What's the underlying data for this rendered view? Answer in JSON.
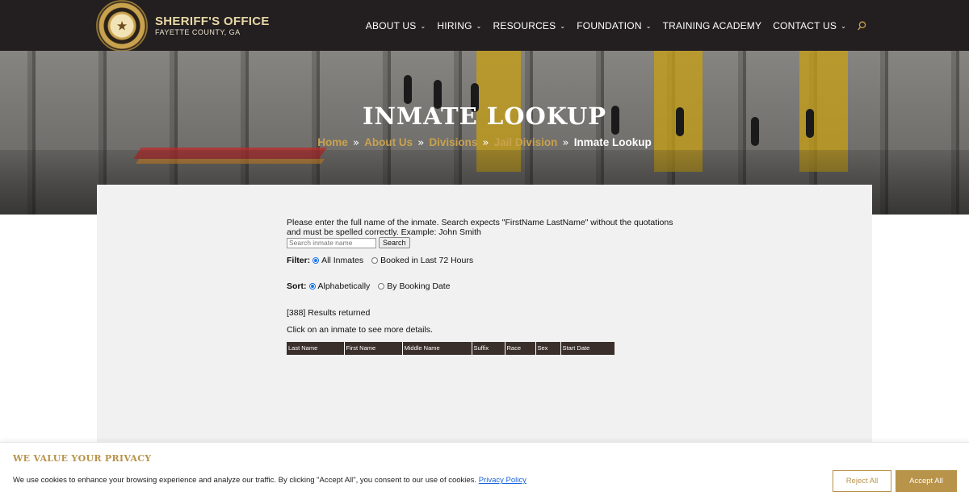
{
  "header": {
    "brand_title": "SHERIFF'S OFFICE",
    "brand_subtitle": "FAYETTE COUNTY, GA",
    "nav": [
      {
        "label": "ABOUT US",
        "icon": "chevron-down-icon"
      },
      {
        "label": "HIRING",
        "icon": "chevron-down-icon"
      },
      {
        "label": "RESOURCES",
        "icon": "chevron-down-icon"
      },
      {
        "label": "FOUNDATION",
        "icon": "chevron-down-icon"
      },
      {
        "label": "TRAINING ACADEMY"
      },
      {
        "label": "CONTACT US",
        "icon": "chevron-down-icon"
      }
    ],
    "search_icon": "search-icon"
  },
  "hero": {
    "title": "INMATE LOOKUP",
    "breadcrumbs": [
      "Home",
      "About Us",
      "Divisions",
      "Jail Division",
      "Inmate Lookup"
    ],
    "separator": "»"
  },
  "lookup": {
    "instructions": "Please enter the full name of the inmate. Search expects \"FirstName LastName\" without the quotations and must be spelled correctly. Example: John Smith",
    "search_placeholder": "Search inmate name",
    "search_button": "Search",
    "filter_label": "Filter:",
    "filter_options": [
      {
        "label": "All Inmates",
        "selected": true
      },
      {
        "label": "Booked in Last 72 Hours",
        "selected": false
      }
    ],
    "sort_label": "Sort:",
    "sort_options": [
      {
        "label": "Alphabetically",
        "selected": true
      },
      {
        "label": "By Booking Date",
        "selected": false
      }
    ],
    "results_text": "[388] Results returned",
    "details_hint": "Click on an inmate to see more details.",
    "table_columns": [
      "Last Name",
      "First Name",
      "Middle Name",
      "Suffix",
      "Race",
      "Sex",
      "Start Date"
    ]
  },
  "cookie_banner": {
    "title": "WE VALUE YOUR PRIVACY",
    "text": "We use cookies to enhance your browsing experience and analyze our traffic. By clicking \"Accept All\", you consent to our use of cookies.",
    "link": "Privacy Policy",
    "reject_button": "Reject All",
    "accept_button": "Accept All"
  },
  "colors": {
    "header_bg": "#231f20",
    "gold_accent": "#c9a24e",
    "cookie_gold": "#b8934a",
    "table_header_bg": "#3b2f2c",
    "link_blue": "#1863dc"
  }
}
